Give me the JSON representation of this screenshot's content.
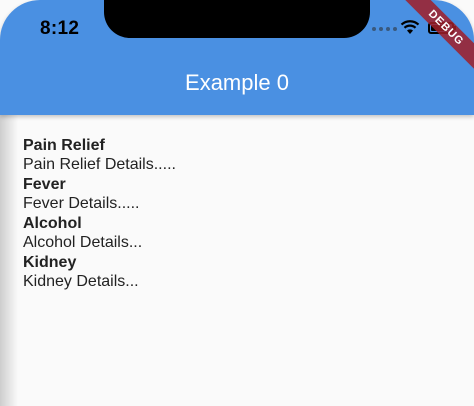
{
  "status_bar": {
    "time": "8:12",
    "icons": [
      "signal-dots-icon",
      "wifi-icon",
      "battery-icon"
    ]
  },
  "debug_banner": "DEBUG",
  "app_bar": {
    "title": "Example 0",
    "color": "#4a90e2"
  },
  "items": [
    {
      "title": "Pain Relief",
      "detail": "Pain Relief Details....."
    },
    {
      "title": "Fever",
      "detail": "Fever Details....."
    },
    {
      "title": "Alcohol",
      "detail": "Alcohol Details..."
    },
    {
      "title": "Kidney",
      "detail": "Kidney Details..."
    }
  ]
}
